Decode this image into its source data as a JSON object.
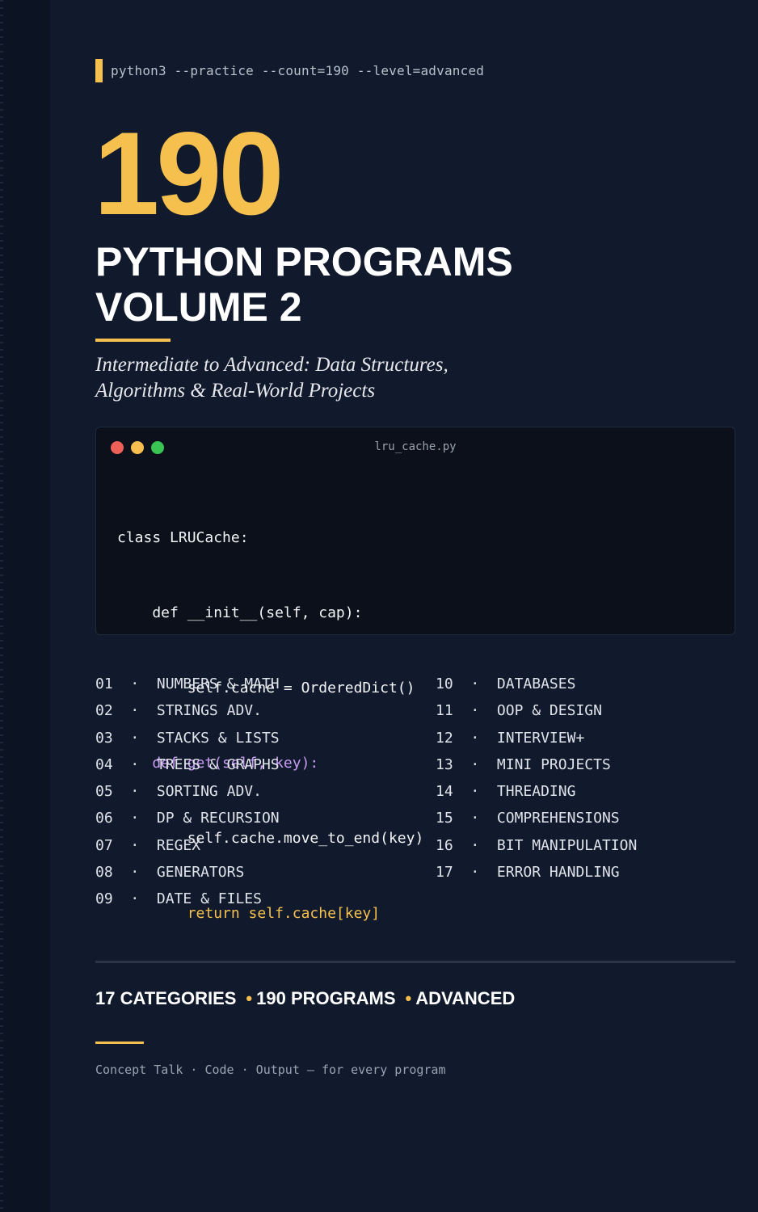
{
  "command": "python3 --practice --count=190 --level=advanced",
  "hero": {
    "number": "190",
    "title_line1": "PYTHON PROGRAMS",
    "title_line2": "VOLUME 2",
    "subtitle_line1": "Intermediate to Advanced: Data Structures,",
    "subtitle_line2": "Algorithms & Real-World Projects"
  },
  "code_window": {
    "filename": "lru_cache.py",
    "lines": [
      "class LRUCache:",
      "    def __init__(self, cap):",
      "        self.cache = OrderedDict()",
      "    def get(self, key):",
      "        self.cache.move_to_end(key)",
      "        return self.cache[key]"
    ]
  },
  "categories_left": [
    {
      "num": "01",
      "label": "NUMBERS & MATH"
    },
    {
      "num": "02",
      "label": "STRINGS ADV."
    },
    {
      "num": "03",
      "label": "STACKS & LISTS"
    },
    {
      "num": "04",
      "label": "TREES & GRAPHS"
    },
    {
      "num": "05",
      "label": "SORTING ADV."
    },
    {
      "num": "06",
      "label": "DP & RECURSION"
    },
    {
      "num": "07",
      "label": "REGEX"
    },
    {
      "num": "08",
      "label": "GENERATORS"
    },
    {
      "num": "09",
      "label": "DATE & FILES"
    }
  ],
  "categories_right": [
    {
      "num": "10",
      "label": "DATABASES"
    },
    {
      "num": "11",
      "label": "OOP & DESIGN"
    },
    {
      "num": "12",
      "label": "INTERVIEW+"
    },
    {
      "num": "13",
      "label": "MINI PROJECTS"
    },
    {
      "num": "14",
      "label": "THREADING"
    },
    {
      "num": "15",
      "label": "COMPREHENSIONS"
    },
    {
      "num": "16",
      "label": "BIT MANIPULATION"
    },
    {
      "num": "17",
      "label": "ERROR HANDLING"
    }
  ],
  "separator": "·",
  "stats": {
    "item1": "17 CATEGORIES",
    "item2": "190 PROGRAMS",
    "item3": "ADVANCED",
    "bullet": "•"
  },
  "tagline": "Concept Talk · Code · Output — for every program",
  "colors": {
    "background": "#111a2c",
    "accent": "#f5c04d",
    "keyword_purple": "#c89bf2"
  }
}
